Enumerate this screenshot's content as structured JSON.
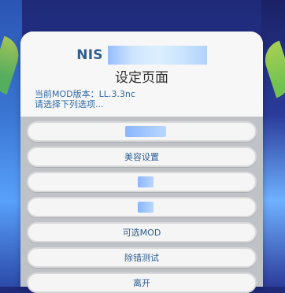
{
  "header": {
    "title_line1_prefix": "NIS",
    "title_line2": "设定页面"
  },
  "info": {
    "version_line": "当前MOD版本：LL.3.3nc",
    "prompt_line": "请选择下列选项..."
  },
  "menu": {
    "items": [
      {
        "label": ""
      },
      {
        "label": "美容设置"
      },
      {
        "label": ""
      },
      {
        "label": ""
      },
      {
        "label": "可选MOD"
      },
      {
        "label": "除错测试"
      },
      {
        "label": "离开"
      }
    ]
  },
  "colors": {
    "panel": "#ffffff",
    "button_text": "#2f5f8f",
    "info_text": "#2e68a5"
  }
}
